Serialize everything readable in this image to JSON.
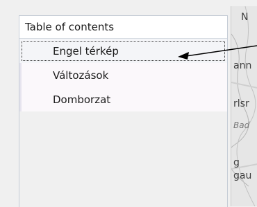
{
  "toc": {
    "title": "Table of contents",
    "items": [
      {
        "label": "Engel térkép",
        "selected": true
      },
      {
        "label": "Változások",
        "selected": false
      },
      {
        "label": "Domborzat",
        "selected": false
      }
    ]
  },
  "map": {
    "labels": [
      "N",
      "ann",
      "rlsr",
      "Bad",
      "g",
      "gau"
    ]
  }
}
